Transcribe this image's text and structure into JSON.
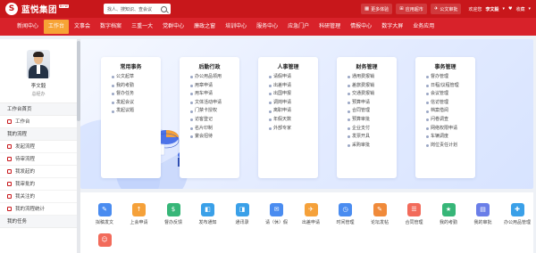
{
  "header": {
    "logo_mark": "S",
    "logo_text": "蓝悦集团",
    "logo_badge": "B+W",
    "search": {
      "placeholder": "找人、搜知识、查会议"
    },
    "links": [
      {
        "icon": "▦",
        "label": "更多体验"
      },
      {
        "icon": "⊞",
        "label": "应用超市"
      },
      {
        "icon": "✈",
        "label": "公文审批"
      }
    ],
    "welcome": "欢迎您",
    "user_name": "李文毅",
    "collect_icon": "♥",
    "collect_label": "收藏"
  },
  "nav": {
    "items": [
      "新闻中心",
      "工作台",
      "文事会",
      "数字档案",
      "三重一大",
      "党群中心",
      "廉政之窗",
      "培训中心",
      "服务中心",
      "应急门户",
      "科研管理",
      "情报中心",
      "数字大屏",
      "业务应用"
    ],
    "active": "工作台"
  },
  "sidebar": {
    "profile_name": "李文毅",
    "profile_role": "总经办",
    "sections": [
      {
        "title": "工作台首页",
        "items": [
          "工作台"
        ]
      },
      {
        "title": "我的流程",
        "items": [
          "发起流程",
          "待审流程",
          "我发起的",
          "我审批的",
          "我关注的",
          "我的流程统计"
        ]
      },
      {
        "title": "我的任务",
        "items": []
      }
    ]
  },
  "banner_cards": [
    {
      "title": "常用事务",
      "items": [
        "公文起草",
        "我的考勤",
        "督办任务",
        "发起会议",
        "发起议题"
      ]
    },
    {
      "title": "后勤行政",
      "items": [
        "办公用品领用",
        "用章申请",
        "用车申请",
        "文体活动申请",
        "门禁卡授权",
        "访客登记",
        "名片印制",
        "宴会招待"
      ]
    },
    {
      "title": "人事管理",
      "items": [
        "请假申请",
        "出差申请",
        "出国申报",
        "调岗申请",
        "离职申请",
        "年假天数",
        "外部专家"
      ]
    },
    {
      "title": "财务管理",
      "items": [
        "通用费报销",
        "差旅费报销",
        "交通费报销",
        "预算申请",
        "合同管理",
        "预算审批",
        "企业支付",
        "发票开具",
        "采购审批"
      ]
    },
    {
      "title": "事务管理",
      "items": [
        "督办管理",
        "日程/议程管理",
        "会议管理",
        "信访管理",
        "档案借阅",
        "问卷调查",
        "网络权限申请",
        "车辆调度",
        "岗位责任计划"
      ]
    }
  ],
  "shortcuts": [
    {
      "icon": "✎",
      "label": "拟稿发文",
      "color": "#4a8cf0"
    },
    {
      "icon": "↑",
      "label": "上会申请",
      "color": "#f5a13a"
    },
    {
      "icon": "$",
      "label": "督办反馈",
      "color": "#37b678"
    },
    {
      "icon": "◧",
      "label": "发布通知",
      "color": "#3aa0e8"
    },
    {
      "icon": "◨",
      "label": "通讯录",
      "color": "#3aa0e8"
    },
    {
      "icon": "✉",
      "label": "请（休）假",
      "color": "#4a8cf0"
    },
    {
      "icon": "✈",
      "label": "出差申请",
      "color": "#f5a13a"
    },
    {
      "icon": "◷",
      "label": "时间管理",
      "color": "#4a8cf0"
    },
    {
      "icon": "✎",
      "label": "论坛发帖",
      "color": "#f08a3a"
    },
    {
      "icon": "☰",
      "label": "合同管理",
      "color": "#f26b5b"
    },
    {
      "icon": "★",
      "label": "我的考勤",
      "color": "#37b678"
    },
    {
      "icon": "▤",
      "label": "我的审批",
      "color": "#6a7ee8"
    },
    {
      "icon": "✚",
      "label": "办公用品管理",
      "color": "#3aa0e8"
    },
    {
      "icon": "☺",
      "label": "",
      "color": "#f26b5b"
    }
  ]
}
